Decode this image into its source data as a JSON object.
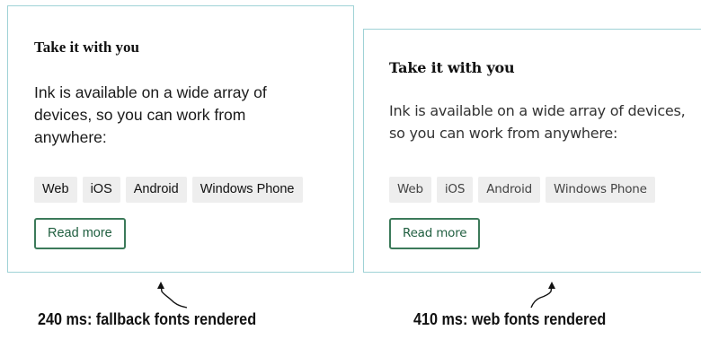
{
  "panels": [
    {
      "title": "Take it with you",
      "body": "Ink is available on a wide array of devices, so you can work from anywhere:",
      "tags": [
        "Web",
        "iOS",
        "Android",
        "Windows Phone"
      ],
      "button_label": "Read more",
      "caption": "240 ms: fallback fonts rendered"
    },
    {
      "title": "Take it with you",
      "body": "Ink is available on a wide array of devices, so you can work from anywhere:",
      "tags": [
        "Web",
        "iOS",
        "Android",
        "Windows Phone"
      ],
      "button_label": "Read more",
      "caption": "410 ms: web fonts rendered"
    }
  ],
  "colors": {
    "card_border": "#9fd2d6",
    "button_border": "#3c7a5a",
    "tag_background": "#eeeeee"
  },
  "icons": {
    "pointer": "up-arrow-icon"
  }
}
